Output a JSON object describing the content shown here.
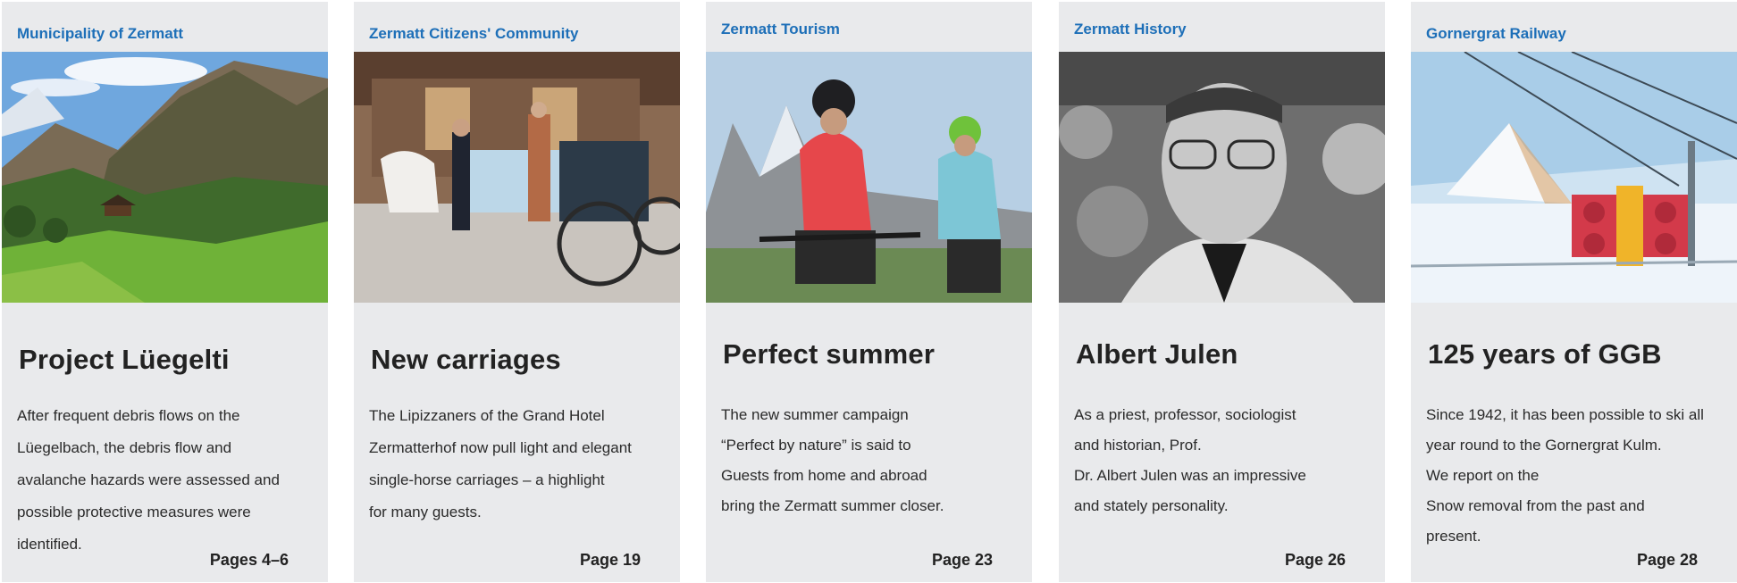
{
  "cards": [
    {
      "kicker": "Municipality of Zermatt",
      "title": "Project Lüegelti",
      "lines": [
        "After frequent debris flows on the",
        "Lüegelbach, the debris flow and",
        "avalanche hazards were assessed and",
        "possible protective measures were",
        "identified."
      ],
      "page": "Pages 4–6",
      "image": "alpine-valley-photo"
    },
    {
      "kicker": "Zermatt Citizens' Community",
      "title": "New carriages",
      "lines": [
        "The Lipizzaners of the Grand Hotel",
        "Zermatterhof now pull light and elegant",
        "single-horse carriages – a highlight",
        "for many guests."
      ],
      "page": "Page 19",
      "image": "horse-carriage-photo"
    },
    {
      "kicker": "Zermatt Tourism",
      "title": "Perfect summer",
      "lines": [
        "The new summer campaign",
        "“Perfect by nature” is said to",
        "Guests from home and abroad",
        "bring the Zermatt summer closer."
      ],
      "page": "Page 23",
      "image": "mountain-bikers-photo"
    },
    {
      "kicker": "Zermatt History",
      "title": "Albert Julen",
      "lines": [
        "As a priest, professor, sociologist",
        "and historian, Prof.",
        "Dr. Albert Julen was an impressive",
        "and stately personality."
      ],
      "page": "Page 26",
      "image": "historic-portrait-photo"
    },
    {
      "kicker": "Gornergrat Railway",
      "title": "125 years of GGB",
      "lines": [
        "Since 1942, it has been possible to ski all",
        "year round to the Gornergrat Kulm.",
        "We report on the",
        "Snow removal from the past and",
        "present."
      ],
      "page": "Page 28",
      "image": "snow-train-photo"
    }
  ],
  "colors": {
    "accent": "#1d6fb8",
    "card_bg": "#e9eaec",
    "text": "#222222"
  }
}
